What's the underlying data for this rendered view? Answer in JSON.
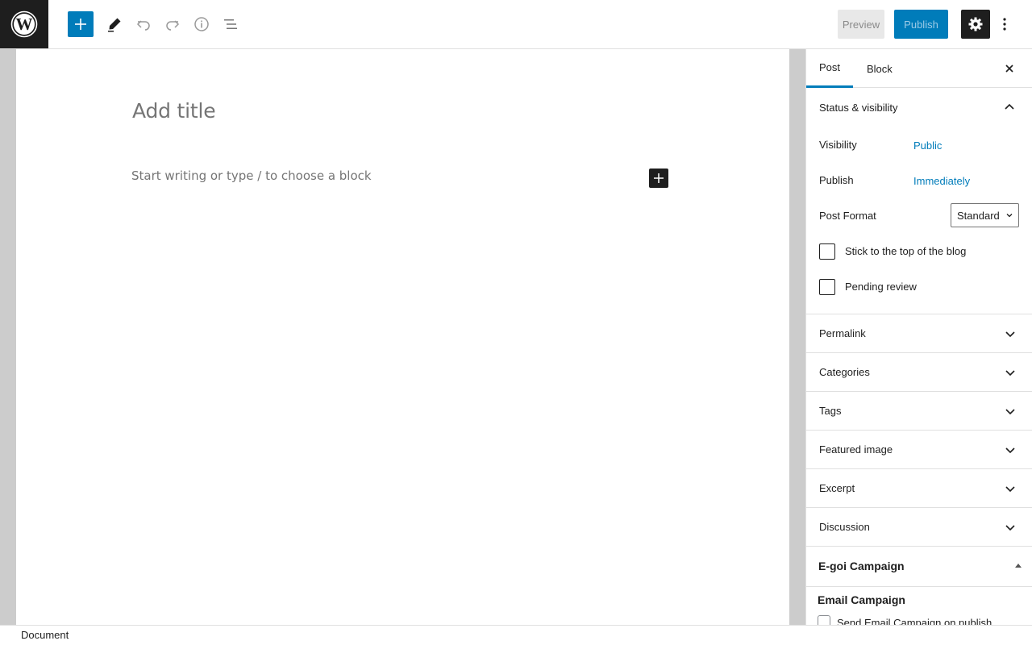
{
  "toolbar": {
    "logo_icon": "wordpress-logo",
    "inserter_icon": "plus-icon",
    "tools_icon": "pencil-icon",
    "undo_icon": "undo-icon",
    "redo_icon": "redo-icon",
    "details_icon": "info-icon",
    "list_view_icon": "list-view-icon",
    "preview_label": "Preview",
    "publish_label": "Publish",
    "settings_icon": "gear-icon",
    "more_icon": "more-vertical-icon"
  },
  "editor": {
    "title_placeholder": "Add title",
    "block_placeholder": "Start writing or type / to choose a block"
  },
  "sidebar": {
    "tabs": [
      {
        "label": "Post",
        "active": true
      },
      {
        "label": "Block",
        "active": false
      }
    ],
    "status_panel": {
      "title": "Status & visibility",
      "visibility_label": "Visibility",
      "visibility_value": "Public",
      "publish_label": "Publish",
      "publish_value": "Immediately",
      "format_label": "Post Format",
      "format_value": "Standard",
      "sticky_label": "Stick to the top of the blog",
      "pending_label": "Pending review"
    },
    "panels": [
      {
        "label": "Permalink"
      },
      {
        "label": "Categories"
      },
      {
        "label": "Tags"
      },
      {
        "label": "Featured image"
      },
      {
        "label": "Excerpt"
      },
      {
        "label": "Discussion"
      }
    ],
    "egoi": {
      "title": "E-goi Campaign",
      "section_title": "Email Campaign",
      "send_label": "Send Email Campaign on publish"
    }
  },
  "footer": {
    "breadcrumb": "Document"
  },
  "colors": {
    "accent": "#007cba",
    "dark": "#1e1e1e"
  }
}
